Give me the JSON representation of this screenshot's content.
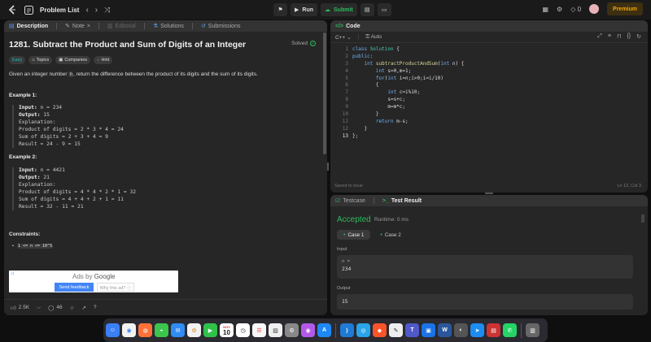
{
  "topbar": {
    "problem_list_label": "Problem List",
    "run_label": "Run",
    "submit_label": "Submit",
    "streak_count": "0",
    "premium_label": "Premium"
  },
  "description": {
    "tabs": [
      "Description",
      "Note",
      "Editorial",
      "Solutions",
      "Submissions"
    ],
    "title": "1281. Subtract the Product and Sum of Digits of an Integer",
    "solved_label": "Solved",
    "chips": [
      "Easy",
      "Topics",
      "Companies",
      "Hint"
    ],
    "statement_before": "Given an integer number ",
    "statement_code": "n",
    "statement_after": ", return the difference between the product of its digits and the sum of its digits.",
    "examples": [
      {
        "heading": "Example 1:",
        "input_label": "Input:",
        "input_value": " n = 234",
        "output_label": "Output:",
        "output_value": " 15",
        "explanation": "Explanation:",
        "lines": [
          "Product of digits = 2 * 3 * 4 = 24",
          "Sum of digits = 2 + 3 + 4 = 9",
          "Result = 24 - 9 = 15"
        ]
      },
      {
        "heading": "Example 2:",
        "input_label": "Input:",
        "input_value": " n = 4421",
        "output_label": "Output:",
        "output_value": " 21",
        "explanation": "Explanation:",
        "lines": [
          "Product of digits = 4 * 4 * 2 * 1 = 32",
          "Sum of digits = 4 + 4 + 2 + 1 = 11",
          "Result = 32 - 11 = 21"
        ]
      }
    ],
    "constraints_heading": "Constraints:",
    "constraint": "1 <= n <= 10^5",
    "ad": {
      "label_a": "Ads by ",
      "label_b": "Google",
      "send_feedback": "Send feedback",
      "why_ad": "Why this ad? ⓘ"
    },
    "footer": {
      "likes": "2.5K",
      "comments": "46"
    }
  },
  "code": {
    "tab_label": "Code",
    "language": "C++",
    "auto_label": "Auto",
    "line_numbers": [
      "1",
      "2",
      "3",
      "4",
      "5",
      "6",
      "7",
      "8",
      "9",
      "10",
      "11",
      "12",
      "13"
    ],
    "lines": [
      {
        "t": "kw",
        "s": "class "
      },
      {
        "t": "ty2",
        "s": "Solution "
      },
      {
        "t": "tx",
        "s": "{"
      }
    ],
    "status": "Saved to local",
    "position": "Ln 13, Col 3"
  },
  "test": {
    "tabs": [
      "Testcase",
      "Test Result"
    ],
    "verdict": "Accepted",
    "runtime": "Runtime: 0 ms",
    "cases": [
      "Case 1",
      "Case 2"
    ],
    "input_label": "Input",
    "input_var": "n =",
    "input_value": "234",
    "output_label": "Output",
    "output_value": "15"
  },
  "dock": {
    "calendar_month": "NOV",
    "calendar_day": "10"
  }
}
